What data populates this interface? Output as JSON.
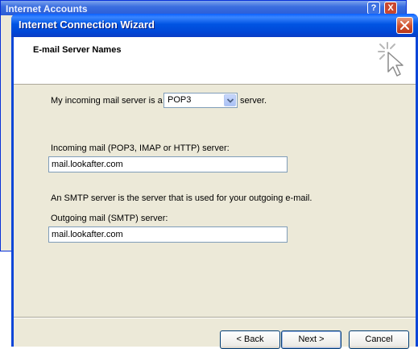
{
  "background_window": {
    "title": "Internet Accounts",
    "help_label": "?",
    "close_label": "X"
  },
  "wizard": {
    "title": "Internet Connection Wizard",
    "header_title": "E-mail Server Names",
    "incoming_prefix": "My incoming mail server is a",
    "incoming_suffix": "server.",
    "server_type": {
      "selected": "POP3"
    },
    "incoming_label": "Incoming mail (POP3, IMAP or HTTP) server:",
    "incoming_value": "mail.lookafter.com",
    "smtp_note": "An SMTP server is the server that is used for your outgoing e-mail.",
    "outgoing_label": "Outgoing mail (SMTP) server:",
    "outgoing_value": "mail.lookafter.com",
    "buttons": {
      "back": "< Back",
      "next": "Next >",
      "cancel": "Cancel"
    }
  },
  "icons": {
    "close": "close-icon",
    "wizard": "wizard-sparkle-cursor-icon",
    "dropdown": "chevron-down-icon"
  },
  "colors": {
    "titlebar": "#0054e3",
    "close_button": "#cf4f2b",
    "dialog_bg": "#ece9d8",
    "input_border": "#7f9db9"
  }
}
